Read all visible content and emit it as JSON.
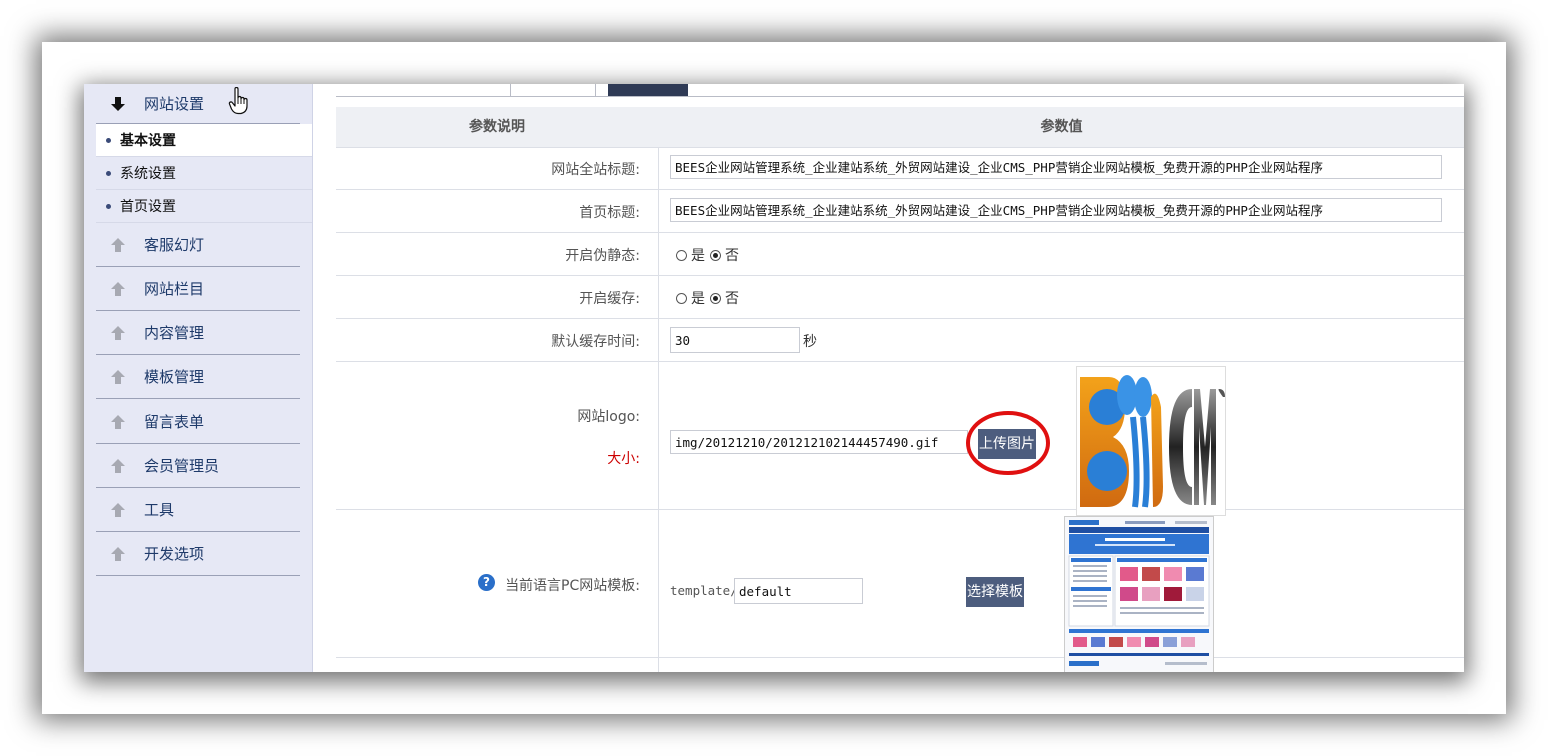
{
  "sidebar": {
    "header_label": "网站设置",
    "sub_items": [
      {
        "label": "基本设置",
        "active": true
      },
      {
        "label": "系统设置",
        "active": false
      },
      {
        "label": "首页设置",
        "active": false
      }
    ],
    "sections": [
      {
        "label": "客服幻灯"
      },
      {
        "label": "网站栏目"
      },
      {
        "label": "内容管理"
      },
      {
        "label": "模板管理"
      },
      {
        "label": "留言表单"
      },
      {
        "label": "会员管理员"
      },
      {
        "label": "工具"
      },
      {
        "label": "开发选项"
      }
    ]
  },
  "table": {
    "col_param_desc": "参数说明",
    "col_param_value": "参数值"
  },
  "form": {
    "site_title_label": "网站全站标题:",
    "site_title_value": "BEES企业网站管理系统_企业建站系统_外贸网站建设_企业CMS_PHP营销企业网站模板_免费开源的PHP企业网站程序",
    "home_title_label": "首页标题:",
    "home_title_value": "BEES企业网站管理系统_企业建站系统_外贸网站建设_企业CMS_PHP营销企业网站模板_免费开源的PHP企业网站程序",
    "pseudo_static_label": "开启伪静态:",
    "cache_label": "开启缓存:",
    "radio_yes": "是",
    "radio_no": "否",
    "pseudo_static_selected": "否",
    "cache_selected": "否",
    "cache_time_label": "默认缓存时间:",
    "cache_time_value": "30",
    "cache_time_unit": "秒",
    "logo_label": "网站logo:",
    "logo_size_label": "大小:",
    "logo_path_value": "img/20121210/201212102144457490.gif",
    "upload_button": "上传图片",
    "template_label": "当前语言PC网站模板:",
    "template_prefix": "template/",
    "template_value": "default",
    "select_template_button": "选择模板"
  },
  "preview": {
    "logo_text_left": "B",
    "logo_text_right": "CMS"
  },
  "colors": {
    "sidebar_bg": "#e6e8f5",
    "button_bg": "#4d5d7e",
    "highlight_circle": "#e01010",
    "size_label": "#cc0000"
  },
  "icons": {
    "header_arrow": "arrow-down-icon",
    "section_arrow": "arrow-up-icon",
    "cursor": "hand-cursor-icon",
    "help": "help-icon"
  }
}
